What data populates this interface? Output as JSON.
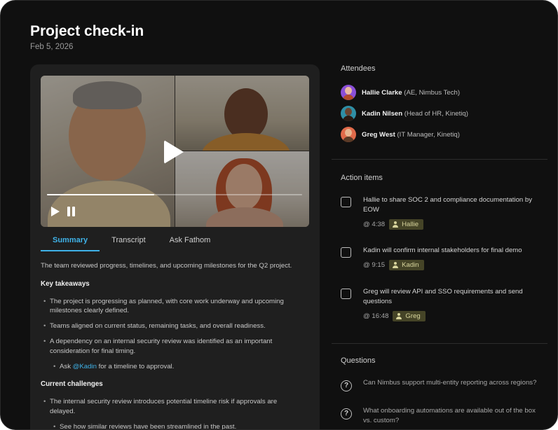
{
  "meeting": {
    "title": "Project check-in",
    "date": "Feb 5, 2026"
  },
  "video": {
    "progress": 0.42
  },
  "tabs": [
    {
      "label": "Summary",
      "active": true
    },
    {
      "label": "Transcript",
      "active": false
    },
    {
      "label": "Ask Fathom",
      "active": false
    }
  ],
  "summary": {
    "intro": "The team reviewed progress, timelines, and upcoming milestones for the Q2 project.",
    "key_takeaways_heading": "Key takeaways",
    "key_takeaways": [
      "The project is progressing as planned, with core work underway and upcoming milestones clearly defined.",
      "Teams aligned on current status, remaining tasks, and overall readiness.",
      "A dependency on an internal security review was identified as an important consideration for final timing."
    ],
    "sub_prefix": "Ask ",
    "sub_mention": "@Kadin",
    "sub_suffix": " for a timeline to approval.",
    "challenges_heading": "Current challenges",
    "challenges": [
      "The internal security review introduces potential timeline risk if approvals are delayed."
    ],
    "challenge_sub": "See how similar reviews have been streamlined in the past."
  },
  "attendees": {
    "heading": "Attendees",
    "list": [
      {
        "name": "Hallie Clarke",
        "role": "(AE, Nimbus Tech)",
        "avatar_bg": "#8a4fd8",
        "skin": "#e8b9a1",
        "hair": "#b24a2a"
      },
      {
        "name": "Kadin Nilsen",
        "role": "(Head of HR, Kinetiq)",
        "avatar_bg": "#2f8fa6",
        "skin": "#6b4430",
        "hair": "#2a1a12"
      },
      {
        "name": "Greg West",
        "role": "(IT Manager, Kinetiq)",
        "avatar_bg": "#e06a4a",
        "skin": "#e6b48f",
        "hair": "#5a3a26"
      }
    ]
  },
  "action_items": {
    "heading": "Action items",
    "list": [
      {
        "text": "Hallie to share SOC 2 and compliance documentation by EOW",
        "time": "@ 4:38",
        "owner": "Hallie"
      },
      {
        "text": "Kadin will confirm internal stakeholders for final demo",
        "time": "@ 9:15",
        "owner": "Kadin"
      },
      {
        "text": "Greg will review API and SSO requirements and send questions",
        "time": "@ 16:48",
        "owner": "Greg"
      }
    ]
  },
  "questions": {
    "heading": "Questions",
    "list": [
      {
        "text": "Can Nimbus support multi-entity reporting across regions?"
      },
      {
        "text": "What onboarding automations are available out of the box vs. custom?"
      }
    ]
  }
}
